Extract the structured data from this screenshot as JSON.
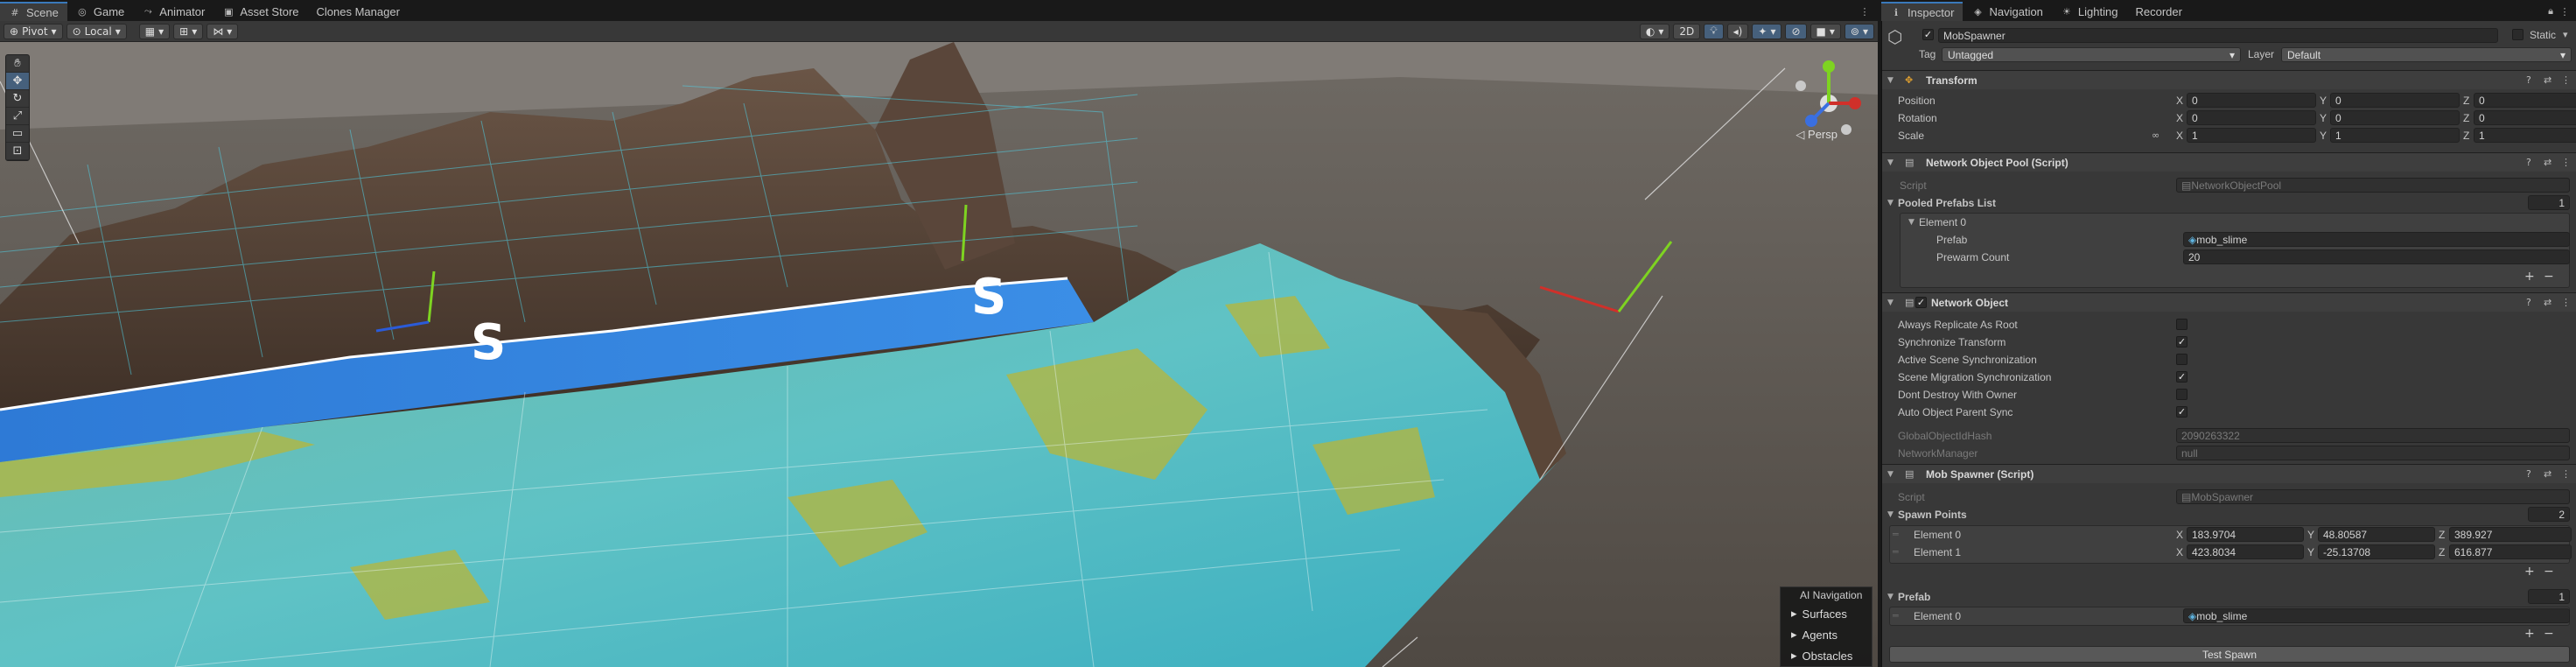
{
  "left_tabs": [
    {
      "label": "Scene",
      "icon": "scene-icon"
    },
    {
      "label": "Game",
      "icon": "game-icon"
    },
    {
      "label": "Animator",
      "icon": "animator-icon"
    },
    {
      "label": "Asset Store",
      "icon": "store-icon"
    },
    {
      "label": "Clones Manager",
      "icon": ""
    }
  ],
  "right_tabs": [
    {
      "label": "Inspector",
      "icon": "inspector-icon"
    },
    {
      "label": "Navigation",
      "icon": "navigation-icon"
    },
    {
      "label": "Lighting",
      "icon": "lighting-icon"
    },
    {
      "label": "Recorder",
      "icon": ""
    }
  ],
  "toolbar": {
    "pivot": "Pivot",
    "local": "Local",
    "mode_2d": "2D"
  },
  "scene": {
    "view_mode": "Persp",
    "ai_nav": {
      "title": "AI Navigation",
      "items": [
        "Surfaces",
        "Agents",
        "Obstacles"
      ]
    }
  },
  "inspector": {
    "object_name": "MobSpawner",
    "static_label": "Static",
    "tag_label": "Tag",
    "tag_value": "Untagged",
    "layer_label": "Layer",
    "layer_value": "Default",
    "transform": {
      "title": "Transform",
      "rows": [
        {
          "label": "Position",
          "x": "0",
          "y": "0",
          "z": "0"
        },
        {
          "label": "Rotation",
          "x": "0",
          "y": "0",
          "z": "0"
        },
        {
          "label": "Scale",
          "x": "1",
          "y": "1",
          "z": "1"
        }
      ]
    },
    "pool": {
      "title": "Network Object Pool (Script)",
      "script_label": "Script",
      "script_value": "NetworkObjectPool",
      "list_label": "Pooled Prefabs List",
      "list_count": "1",
      "element_label": "Element 0",
      "prefab_label": "Prefab",
      "prefab_value": "mob_slime",
      "prewarm_label": "Prewarm Count",
      "prewarm_value": "20"
    },
    "netobj": {
      "title": "Network Object",
      "props": [
        {
          "label": "Always Replicate As Root",
          "checked": false
        },
        {
          "label": "Synchronize Transform",
          "checked": true
        },
        {
          "label": "Active Scene Synchronization",
          "checked": false
        },
        {
          "label": "Scene Migration Synchronization",
          "checked": true
        },
        {
          "label": "Dont Destroy With Owner",
          "checked": false
        },
        {
          "label": "Auto Object Parent Sync",
          "checked": true
        }
      ],
      "hash_label": "GlobalObjectIdHash",
      "hash_value": "2090263322",
      "nm_label": "NetworkManager",
      "nm_value": "null"
    },
    "mob": {
      "title": "Mob Spawner (Script)",
      "script_label": "Script",
      "script_value": "MobSpawner",
      "points_label": "Spawn Points",
      "points_count": "2",
      "points": [
        {
          "label": "Element 0",
          "x": "183.9704",
          "y": "48.80587",
          "z": "389.927"
        },
        {
          "label": "Element 1",
          "x": "423.8034",
          "y": "-25.13708",
          "z": "616.877"
        }
      ],
      "prefab_label": "Prefab",
      "prefab_count": "1",
      "prefab_element": "Element 0",
      "prefab_value": "mob_slime",
      "button": "Test Spawn"
    },
    "axes": {
      "x": "X",
      "y": "Y",
      "z": "Z"
    },
    "plus": "+",
    "minus": "−"
  }
}
